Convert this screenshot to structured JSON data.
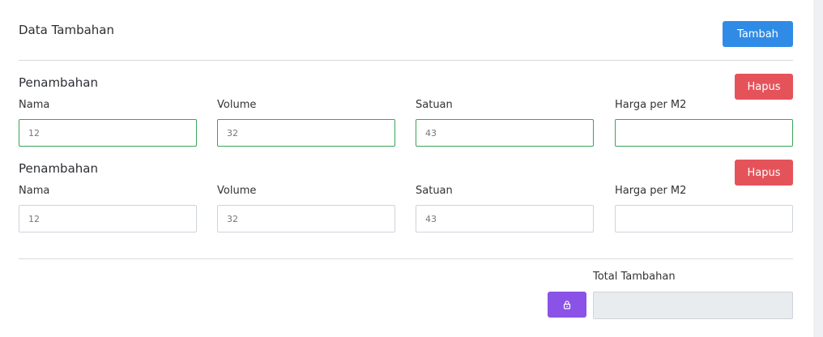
{
  "header": {
    "title": "Data Tambahan",
    "add_button": "Tambah"
  },
  "rows": [
    {
      "title": "Penambahan",
      "delete_button": "Hapus",
      "labels": [
        "Nama",
        "Volume",
        "Satuan",
        "Harga per M2"
      ],
      "values": [
        "12",
        "32",
        "43",
        ""
      ],
      "validated": true
    },
    {
      "title": "Penambahan",
      "delete_button": "Hapus",
      "labels": [
        "Nama",
        "Volume",
        "Satuan",
        "Harga per M2"
      ],
      "values": [
        "12",
        "32",
        "43",
        ""
      ],
      "validated": false
    }
  ],
  "footer": {
    "total_label": "Total Tambahan",
    "total_value": "",
    "lock_icon": "lock-icon"
  },
  "colors": {
    "primary": "#2f8be6",
    "danger": "#e5535a",
    "success_border": "#3aa45a",
    "purple": "#8a52e6",
    "readonly_bg": "#e9ecef"
  }
}
